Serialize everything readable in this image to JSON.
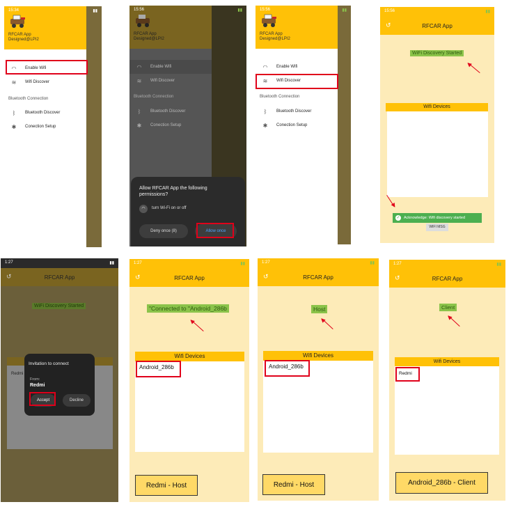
{
  "drawer": {
    "app_name": "RFCAR App",
    "designed_by": "Designed@LPI2",
    "items": {
      "enable_wifi": "Enable Wifi",
      "wifi_discover": "Wifi Discover",
      "section_bt": "Bluetooth Connection",
      "bt_discover": "Bluetooth Discover",
      "conn_setup": "Conection Setup"
    }
  },
  "times": {
    "s1": "15:34",
    "s2": "15:56",
    "s3": "15:56",
    "s4": "15:56",
    "s5": "1:27",
    "s6": "1:27",
    "s7": "1:27",
    "s8": "1:27"
  },
  "permission": {
    "question": "Allow RFCAR App the following permissions?",
    "perm": "turn Wi-Fi on or off",
    "deny": "Deny once (8)",
    "allow": "Allow once"
  },
  "app": {
    "title4": "RFCAR App",
    "title": "RFCAR App",
    "discovery_started": "WiFi Discovery Started",
    "wifi_devices": "Wifi Devices",
    "toast": "Acknowledge: Wifi discovery started",
    "wifi_msg_btn": "WIFI MSG"
  },
  "invite": {
    "title": "Invitation to connect",
    "from_label": "From:",
    "from_name": "Redmi",
    "accept": "Accept",
    "decline": "Decline",
    "peek": "Redmi"
  },
  "status": {
    "connected": "\"Connected to \"Android_286b",
    "host": "Host",
    "client": "Client"
  },
  "devices": {
    "android": "Android_286b",
    "redmi": "Redmi"
  },
  "captions": {
    "c1": "Redmi - Host",
    "c2": "Redmi - Host",
    "c3": "Android_286b - Client"
  },
  "colors": {
    "accent": "#ffc107",
    "highlight": "#8bc34a",
    "annotation": "#e0001a",
    "background": "#fdebb8"
  }
}
